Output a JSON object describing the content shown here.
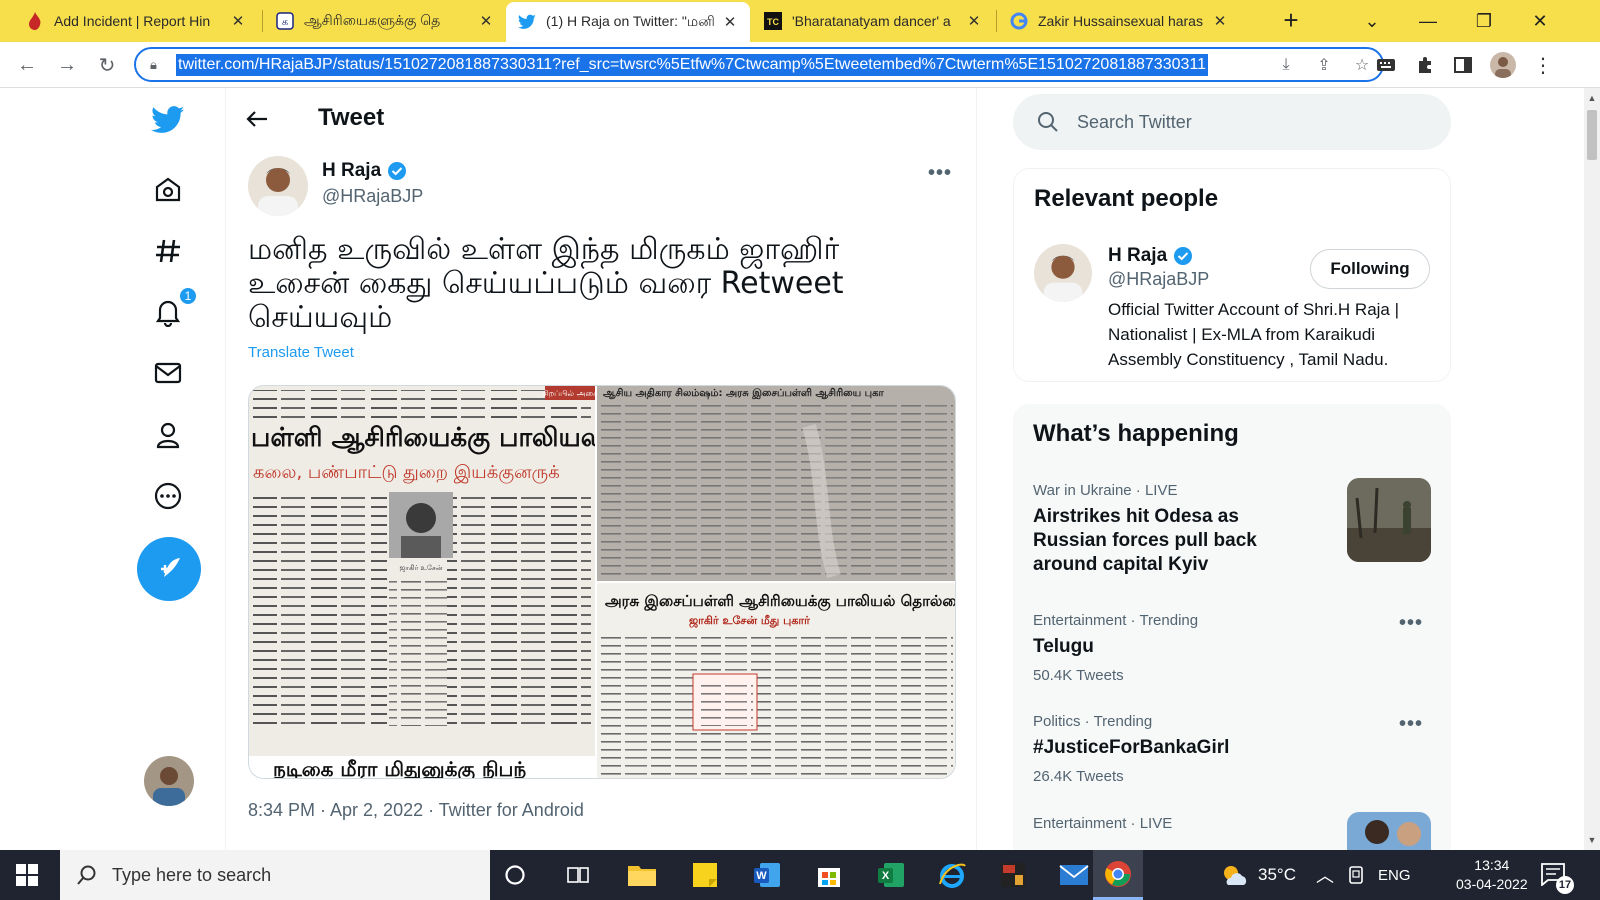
{
  "browser": {
    "tabs": [
      {
        "label": "Add Incident | Report Hin",
        "icon": "flame-icon"
      },
      {
        "label": "ஆசிரியைகளுக்கு தெ",
        "icon": "g-letter-icon"
      },
      {
        "label": "(1) H Raja on Twitter: \"மனி",
        "icon": "twitter-bird-icon"
      },
      {
        "label": "'Bharatanatyam dancer' a",
        "icon": "tc-icon"
      },
      {
        "label": "Zakir Hussainsexual haras",
        "icon": "google-icon"
      }
    ],
    "url": "twitter.com/HRajaBJP/status/1510272081887330311?ref_src=twsrc%5Etfw%7Ctwcamp%5Etweetembed%7Ctwterm%5E1510272081887330311"
  },
  "nav": {
    "notification_count": "1"
  },
  "tweet": {
    "header_title": "Tweet",
    "author_name": "H Raja",
    "author_handle": "@HRajaBJP",
    "text": "மனித உருவில் உள்ள இந்த மிருகம் ஜாஹிர் உசைன் கைது செய்யப்படும் வரை Retweet செய்யவும்",
    "translate_label": "Translate Tweet",
    "meta": "8:34 PM · Apr 2, 2022 · Twitter for Android",
    "media_headlines": {
      "left_headline": "பள்ளி ஆசிரியைக்கு பாலியல",
      "left_sub": "கலை, பண்பாட்டு துறை இயக்குனருக்",
      "left_tag": "சிறப்பில் அசை",
      "left_caption": "ஜாகிர் உசேன்",
      "left_bottom": "நடிகை மீரா மிதுனுக்கு நிபந்",
      "top_right_headline": "ஆசிய அதிகார சிலம்ஷம்: அரசு இசைப்பள்ளி ஆசிரியை புகா",
      "bottom_right_headline": "அரசு இசைப்பள்ளி ஆசிரியைக்கு பாலியல் தொல்லை",
      "bottom_right_sub": "ஜாகிர் உசேன் மீது புகார்"
    }
  },
  "sidebar": {
    "search_placeholder": "Search Twitter",
    "relevant_title": "Relevant people",
    "person": {
      "name": "H Raja",
      "handle": "@HRajaBJP",
      "button": "Following",
      "bio": "Official Twitter Account of Shri.H Raja | Nationalist | Ex-MLA from Karaikudi Assembly Constituency , Tamil Nadu."
    },
    "happening_title": "What’s happening",
    "trends": [
      {
        "context": "War in Ukraine · LIVE",
        "name": "Airstrikes hit Odesa as Russian forces pull back around capital Kyiv",
        "count": ""
      },
      {
        "context": "Entertainment · Trending",
        "name": "Telugu",
        "count": "50.4K Tweets"
      },
      {
        "context": "Politics · Trending",
        "name": "#JusticeForBankaGirl",
        "count": "26.4K Tweets"
      },
      {
        "context": "Entertainment · LIVE",
        "name": "",
        "count": ""
      }
    ]
  },
  "taskbar": {
    "search_placeholder": "Type here to search",
    "temperature": "35°C",
    "language": "ENG",
    "time": "13:34",
    "date": "03-04-2022",
    "notification_count": "17"
  },
  "colors": {
    "twitter_blue": "#1d9bf0",
    "tabbar_yellow": "#f7df4b",
    "taskbar_bg": "#1f2430"
  }
}
